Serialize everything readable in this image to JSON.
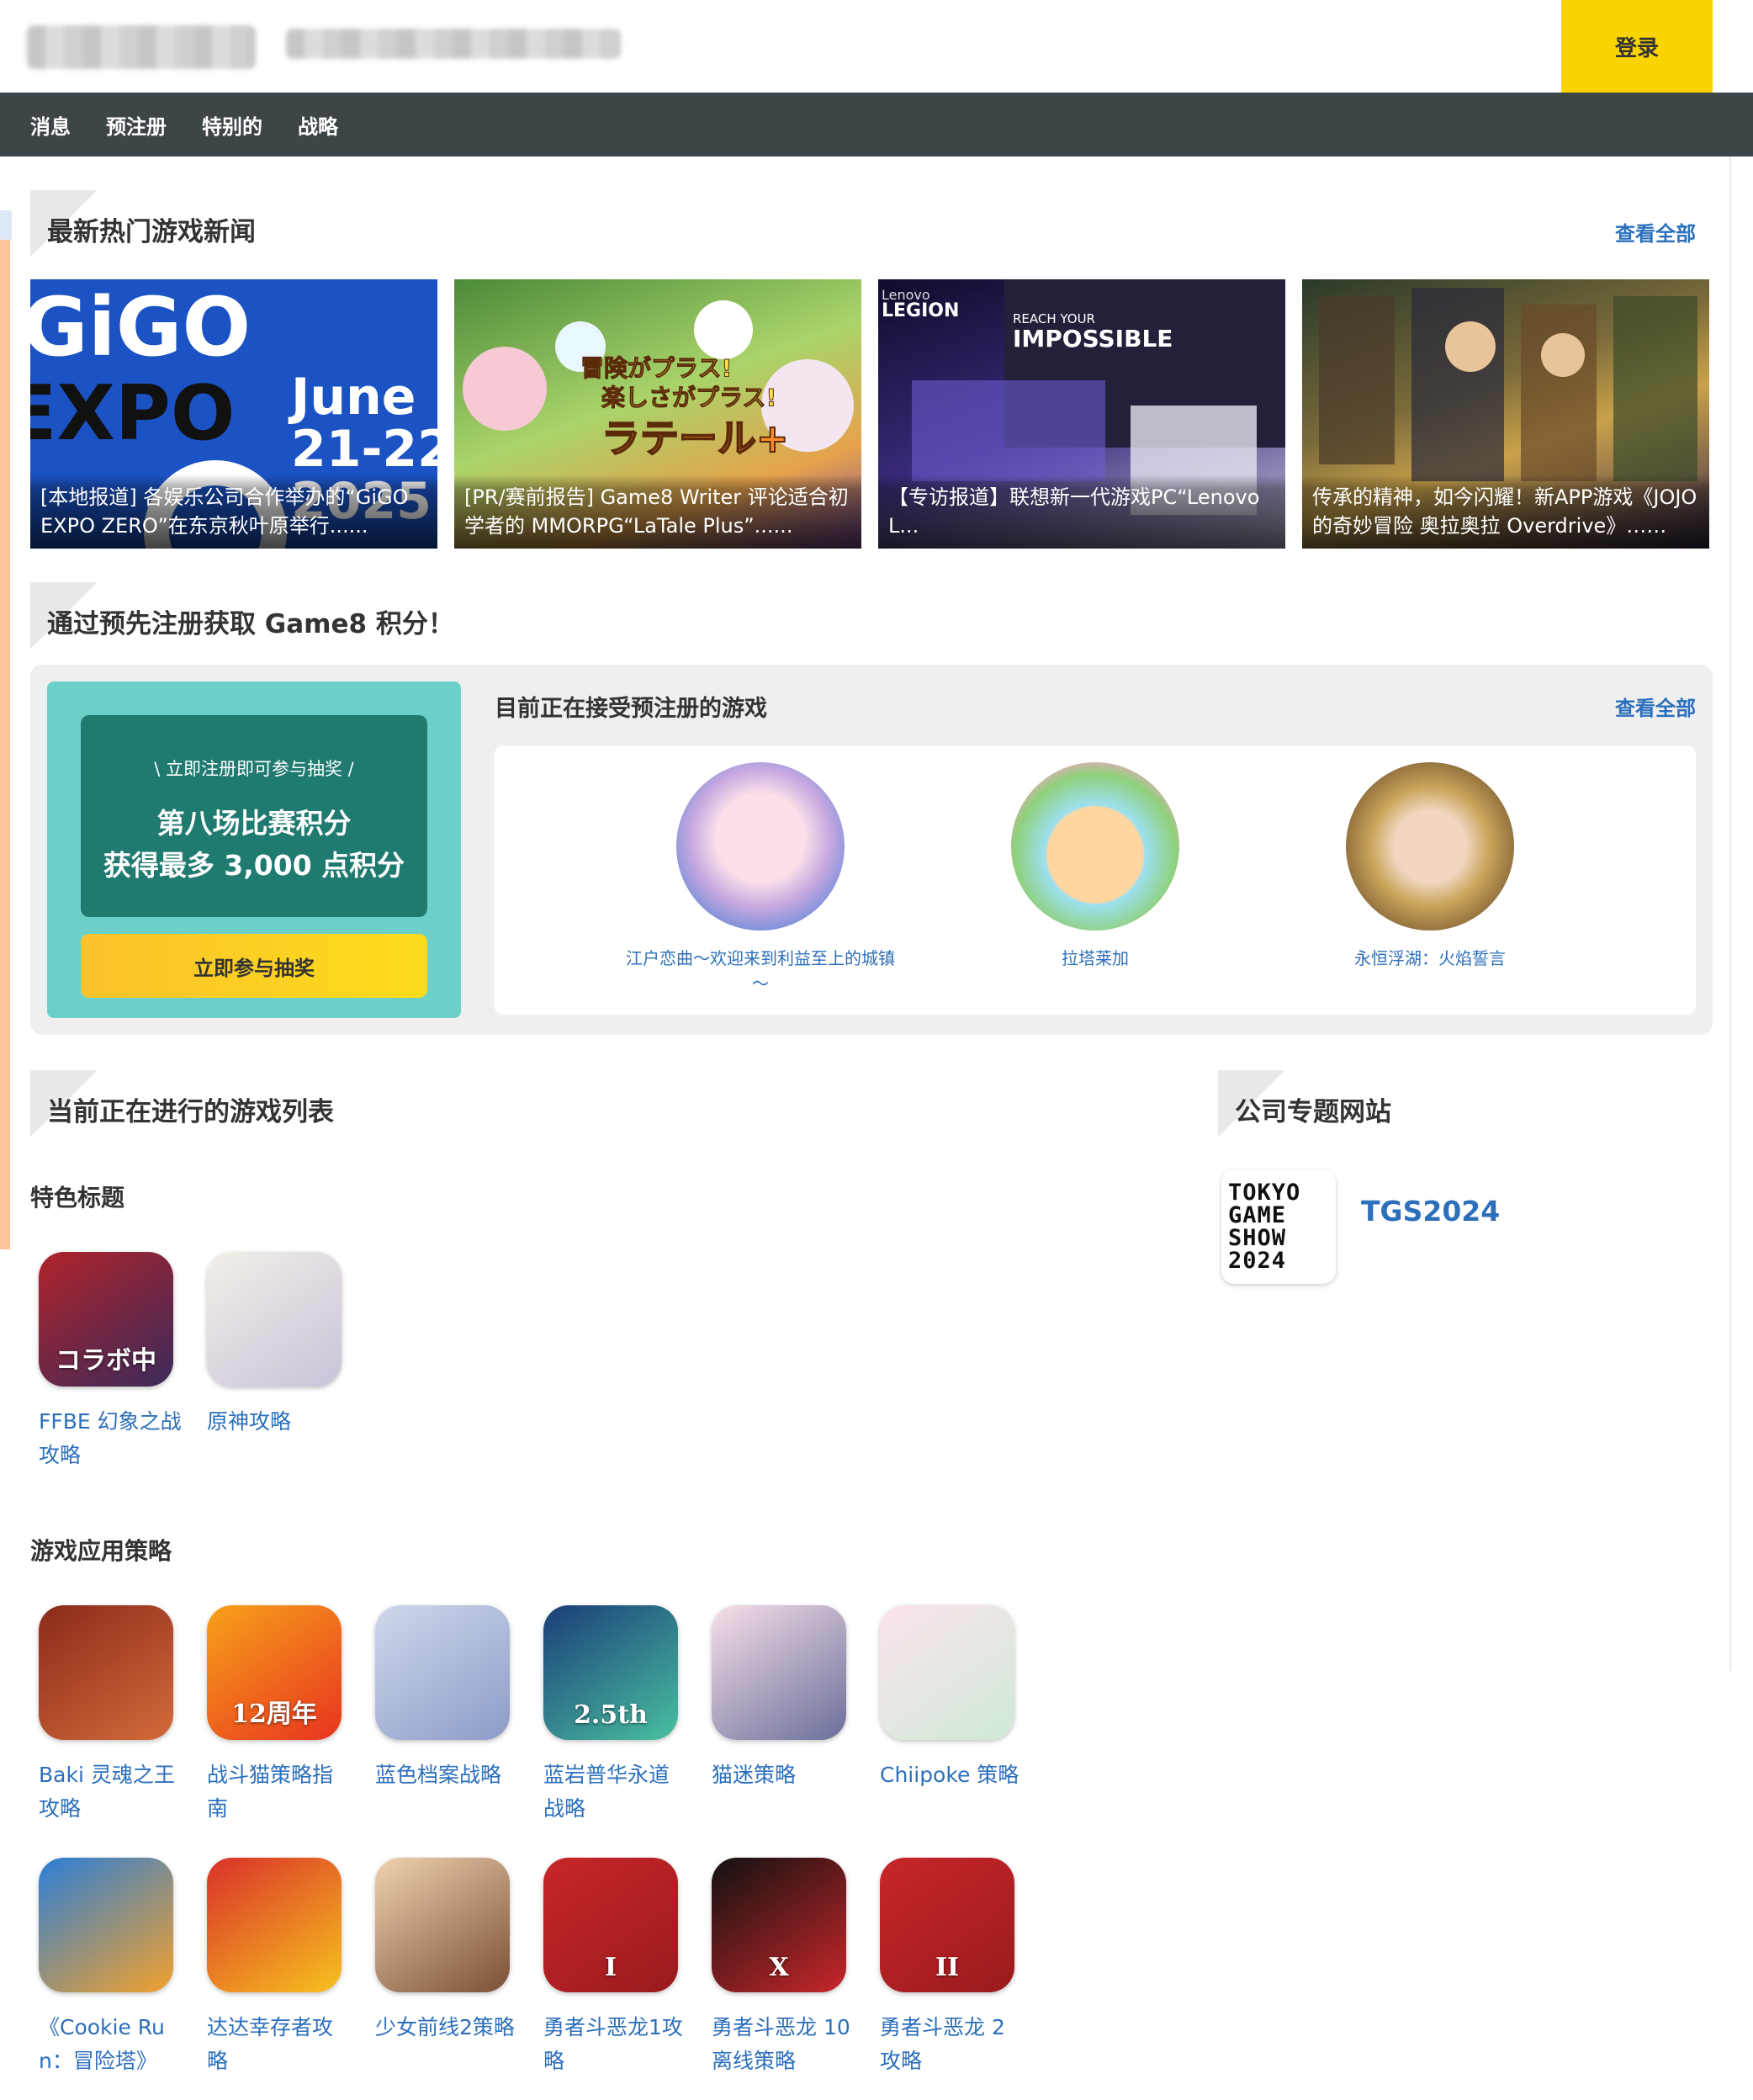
{
  "header": {
    "login_label": "登录",
    "nav": [
      "消息",
      "预注册",
      "特别的",
      "战略"
    ]
  },
  "news": {
    "title": "最新热门游戏新闻",
    "see_all": "查看全部",
    "cards": [
      {
        "caption": "[本地报道] 各娱乐公司合作举办的“GiGO EXPO ZERO”在东京秋叶原举行......",
        "art": [
          "GiGO",
          "EXPO",
          "June",
          "21-22",
          "2025"
        ]
      },
      {
        "caption": "[PR/赛前报告] Game8 Writer 评论适合初学者的 MMORPG“LaTale Plus”......",
        "art": [
          "冒険がプラス!",
          "楽しさがプラス!",
          "ラテール+"
        ]
      },
      {
        "caption": "【专访报道】联想新一代游戏PC“Lenovo L...",
        "art": [
          "Lenovo",
          "LEGION",
          "REACH YOUR",
          "IMPOSSIBLE"
        ]
      },
      {
        "caption": "传承的精神，如今闪耀！新APP游戏《JOJO的奇妙冒险 奥拉奥拉 Overdrive》……",
        "art": []
      }
    ]
  },
  "prereg": {
    "title": "通过预先注册获取 Game8 积分！",
    "promo_small": "\\ 立即注册即可参与抽奖 /",
    "promo_line1": "第八场比赛积分",
    "promo_line2": "获得最多 3,000 点积分",
    "raffle_button": "立即参与抽奖",
    "sub_title": "目前正在接受预注册的游戏",
    "see_all": "查看全部",
    "games": [
      {
        "name": "江户恋曲～欢迎来到利益至上的城镇～"
      },
      {
        "name": "拉塔莱加"
      },
      {
        "name": "永恒浮湖：火焰誓言"
      }
    ]
  },
  "games": {
    "title": "当前正在进行的游戏列表",
    "featured_title": "特色标题",
    "featured": [
      {
        "name": "FFBE 幻象之战攻略",
        "colors": [
          "#b0232a",
          "#3b2a5a"
        ],
        "icon_text": "コラボ中"
      },
      {
        "name": "原神攻略",
        "colors": [
          "#f2efe8",
          "#c9c3d8"
        ],
        "icon_text": ""
      }
    ],
    "apps_title": "游戏应用策略",
    "apps": [
      {
        "name": "Baki 灵魂之王攻略",
        "colors": [
          "#8a2a1a",
          "#d36a3a"
        ],
        "icon_text": ""
      },
      {
        "name": "战斗猫策略指南",
        "colors": [
          "#f7a21a",
          "#e8331f"
        ],
        "icon_text": "12周年"
      },
      {
        "name": "蓝色档案战略",
        "colors": [
          "#cfd7ea",
          "#8c9cc8"
        ],
        "icon_text": ""
      },
      {
        "name": "蓝岩普华永道战略",
        "colors": [
          "#1b3d78",
          "#49c0a0"
        ],
        "icon_text": "2.5th"
      },
      {
        "name": "猫迷策略",
        "colors": [
          "#f7dfe8",
          "#6a6f9a"
        ],
        "icon_text": ""
      },
      {
        "name": "Chiipoke 策略",
        "colors": [
          "#fbe4ec",
          "#cfe9d6"
        ],
        "icon_text": ""
      },
      {
        "name": "《Cookie Run：冒险塔》",
        "colors": [
          "#2a7ed8",
          "#f3a12c"
        ],
        "icon_text": ""
      },
      {
        "name": "达达幸存者攻略",
        "colors": [
          "#d9302a",
          "#f7c21e"
        ],
        "icon_text": ""
      },
      {
        "name": "少女前线2策略",
        "colors": [
          "#f0d2b0",
          "#7a5036"
        ],
        "icon_text": ""
      },
      {
        "name": "勇者斗恶龙1攻略",
        "colors": [
          "#c8262a",
          "#9a1a1c"
        ],
        "icon_text": "I"
      },
      {
        "name": "勇者斗恶龙 10 离线策略",
        "colors": [
          "#111111",
          "#c8262a"
        ],
        "icon_text": "X"
      },
      {
        "name": "勇者斗恶龙 2 攻略",
        "colors": [
          "#c8262a",
          "#9a1a1c"
        ],
        "icon_text": "II"
      }
    ]
  },
  "company": {
    "title": "公司专题网站",
    "logo_text": [
      "TOKYO",
      "GAME",
      "SHOW",
      "2024"
    ],
    "site_name": "TGS2024"
  }
}
